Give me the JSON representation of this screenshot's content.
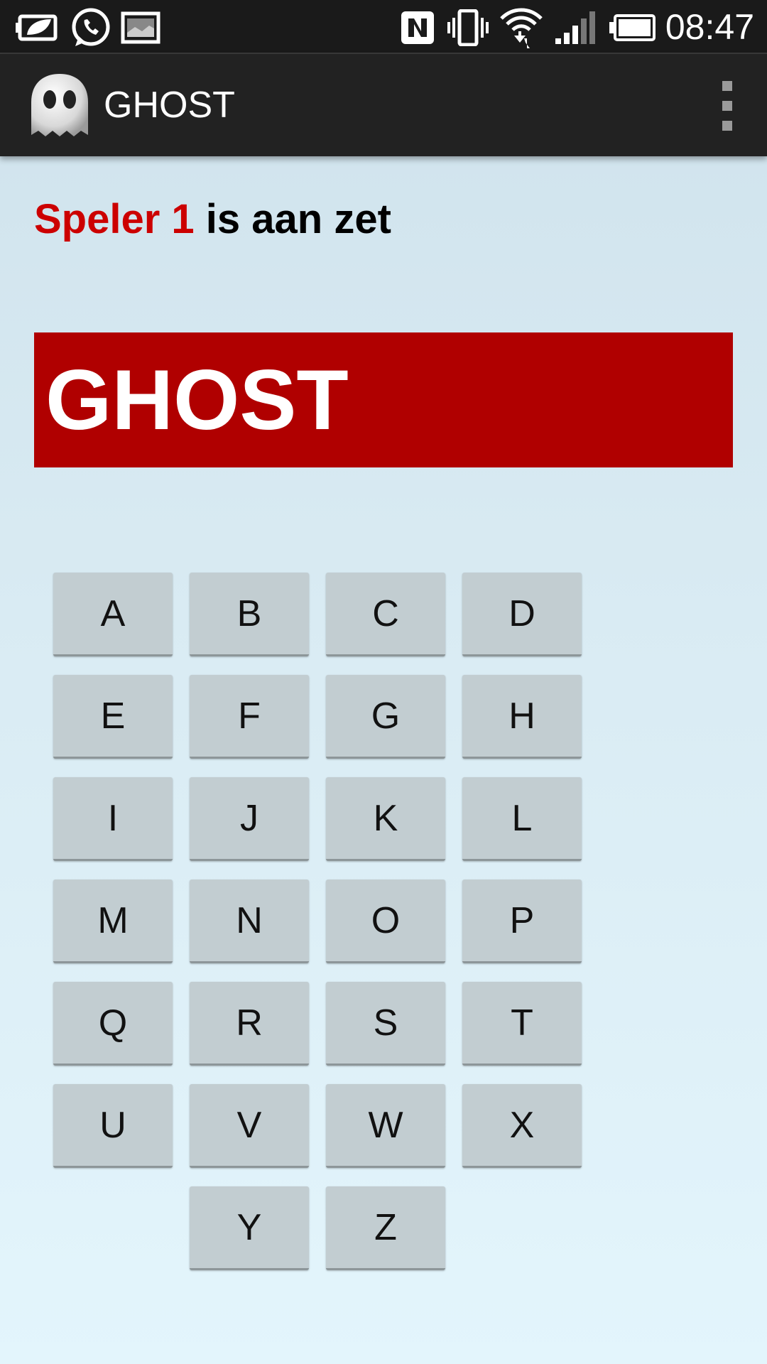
{
  "status_bar": {
    "time": "08:47",
    "icons": [
      "battery-saver-icon",
      "whatsapp-icon",
      "image-notification-icon",
      "nfc-icon",
      "vibrate-icon",
      "wifi-icon",
      "signal-icon",
      "battery-icon"
    ]
  },
  "action_bar": {
    "title": "GHOST",
    "logo_icon": "ghost-icon",
    "menu_icon": "overflow-menu-icon"
  },
  "turn": {
    "player": "Speler 1",
    "suffix": " is aan zet"
  },
  "word": {
    "text": "GHOST"
  },
  "keyboard": {
    "keys": [
      "A",
      "B",
      "C",
      "D",
      "E",
      "F",
      "G",
      "H",
      "I",
      "J",
      "K",
      "L",
      "M",
      "N",
      "O",
      "P",
      "Q",
      "R",
      "S",
      "T",
      "U",
      "V",
      "W",
      "X",
      "Y",
      "Z"
    ]
  },
  "colors": {
    "accent_red": "#b00000",
    "player_red": "#cc0000",
    "key_bg": "#c2cdd1",
    "action_bar": "#222222"
  }
}
